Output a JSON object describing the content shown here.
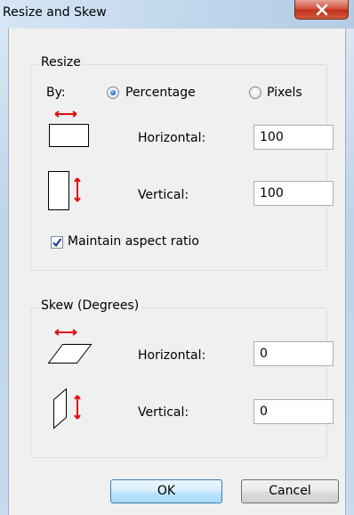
{
  "window": {
    "title": "Resize and Skew"
  },
  "resize": {
    "group_label": "Resize",
    "by_label": "By:",
    "options": [
      {
        "label": "Percentage",
        "selected": true
      },
      {
        "label": "Pixels",
        "selected": false
      }
    ],
    "horizontal_label": "Horizontal:",
    "horizontal_value": "100",
    "vertical_label": "Vertical:",
    "vertical_value": "100",
    "maintain_aspect_label": "Maintain aspect ratio",
    "maintain_aspect_checked": true
  },
  "skew": {
    "group_label": "Skew (Degrees)",
    "horizontal_label": "Horizontal:",
    "horizontal_value": "0",
    "vertical_label": "Vertical:",
    "vertical_value": "0"
  },
  "buttons": {
    "ok": "OK",
    "cancel": "Cancel"
  },
  "icons": {
    "close": "close-icon",
    "resize_horizontal": "resize-horizontal-icon",
    "resize_vertical": "resize-vertical-icon",
    "skew_horizontal": "skew-horizontal-icon",
    "skew_vertical": "skew-vertical-icon",
    "checkmark": "checkmark-icon"
  },
  "colors": {
    "arrow": "#e01010",
    "radio_selected": "#1f6fc2",
    "checkmark": "#1c3f8f",
    "close_button": "#c2331c"
  }
}
